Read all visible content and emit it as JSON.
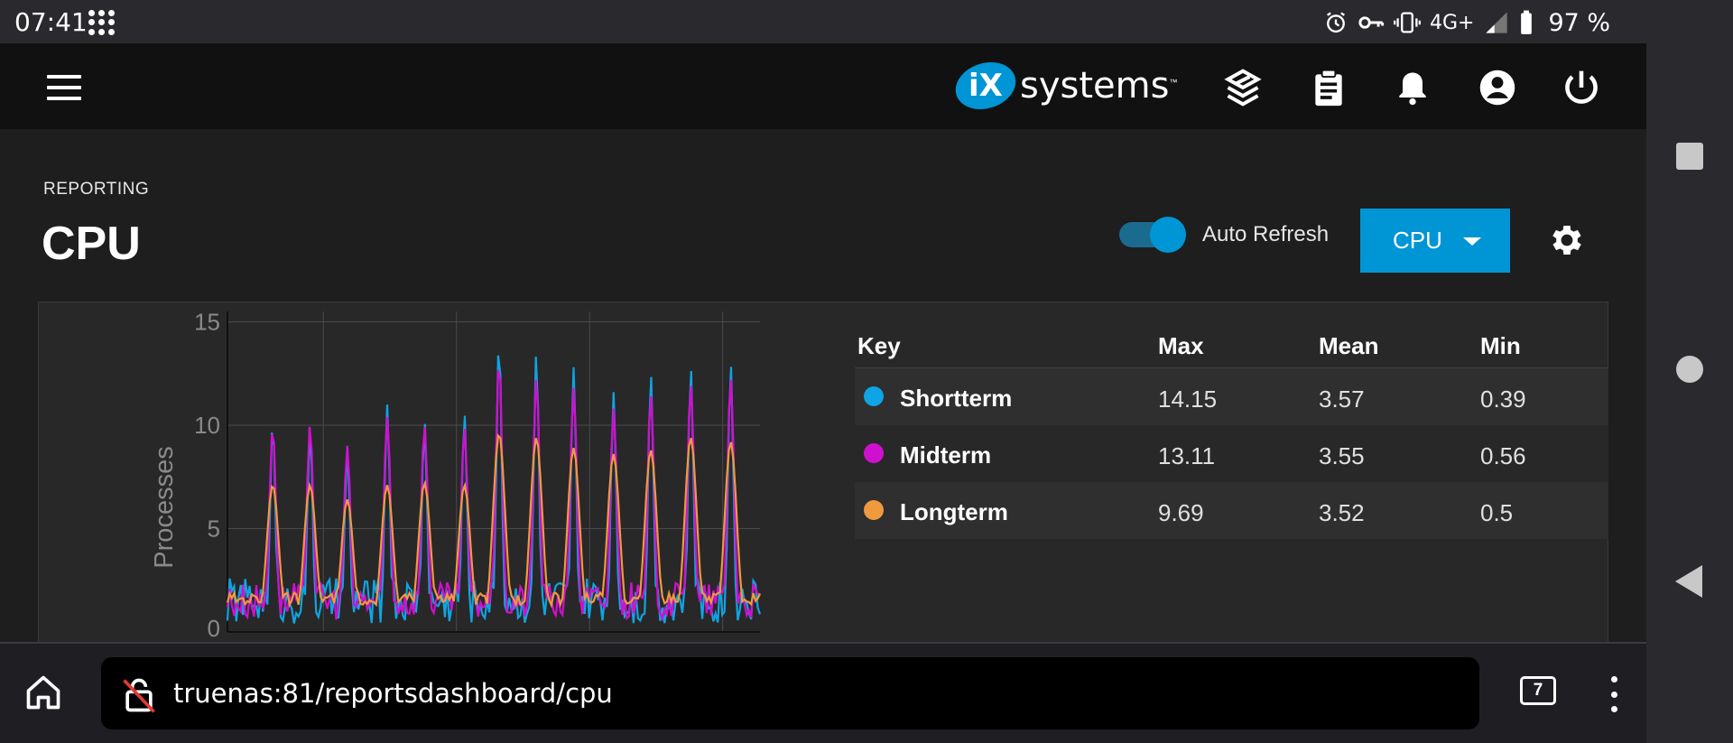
{
  "status_bar": {
    "time": "07:41",
    "network": "4G+",
    "battery": "97 %",
    "icons": [
      "apps-grid-icon",
      "alarm-icon",
      "vpn-key-icon",
      "vibrate-icon",
      "signal-icon",
      "battery-icon"
    ]
  },
  "topbar": {
    "logo_ix": "iX",
    "logo_text": "systems",
    "logo_tm": "™",
    "icons": [
      "menu-icon",
      "truecommand-icon",
      "tasks-icon",
      "bell-icon",
      "account-icon",
      "power-icon"
    ]
  },
  "page": {
    "breadcrumb": "REPORTING",
    "title": "CPU"
  },
  "controls": {
    "auto_refresh_label": "Auto Refresh",
    "auto_refresh_on": true,
    "report_select_value": "CPU"
  },
  "chart_data": {
    "type": "line",
    "ylabel": "Processes",
    "yticks": [
      "15",
      "10",
      "5",
      "0"
    ],
    "ylim": [
      0,
      15.5
    ],
    "grid": true,
    "colors": {
      "Shortterm": "#0fa4e3",
      "Midterm": "#d010d0",
      "Longterm": "#ef9a3e"
    },
    "peaks": [
      {
        "x": 0.085,
        "short": 10.2,
        "mid": 9.9,
        "long": 7.1
      },
      {
        "x": 0.155,
        "short": 10.0,
        "mid": 10.0,
        "long": 7.1
      },
      {
        "x": 0.225,
        "short": 9.0,
        "mid": 9.0,
        "long": 6.4
      },
      {
        "x": 0.3,
        "short": 11.0,
        "mid": 10.4,
        "long": 7.1
      },
      {
        "x": 0.37,
        "short": 10.2,
        "mid": 10.0,
        "long": 7.2
      },
      {
        "x": 0.445,
        "short": 10.6,
        "mid": 9.9,
        "long": 7.1
      },
      {
        "x": 0.51,
        "short": 14.15,
        "mid": 13.11,
        "long": 9.6
      },
      {
        "x": 0.58,
        "short": 13.5,
        "mid": 12.3,
        "long": 9.4
      },
      {
        "x": 0.65,
        "short": 12.8,
        "mid": 11.8,
        "long": 8.9
      },
      {
        "x": 0.725,
        "short": 11.6,
        "mid": 10.8,
        "long": 8.6
      },
      {
        "x": 0.795,
        "short": 12.5,
        "mid": 11.5,
        "long": 8.8
      },
      {
        "x": 0.87,
        "short": 12.8,
        "mid": 12.0,
        "long": 9.4
      },
      {
        "x": 0.945,
        "short": 13.0,
        "mid": 12.3,
        "long": 9.2
      }
    ]
  },
  "legend": {
    "headers": {
      "key": "Key",
      "max": "Max",
      "mean": "Mean",
      "min": "Min"
    },
    "rows": [
      {
        "name": "Shortterm",
        "color": "#0fa4e3",
        "max": "14.15",
        "mean": "3.57",
        "min": "0.39"
      },
      {
        "name": "Midterm",
        "color": "#d010d0",
        "max": "13.11",
        "mean": "3.55",
        "min": "0.56"
      },
      {
        "name": "Longterm",
        "color": "#ef9a3e",
        "max": "9.69",
        "mean": "3.52",
        "min": "0.5"
      }
    ]
  },
  "browser": {
    "url": "truenas:81/reportsdashboard/cpu",
    "tab_count": "7"
  }
}
